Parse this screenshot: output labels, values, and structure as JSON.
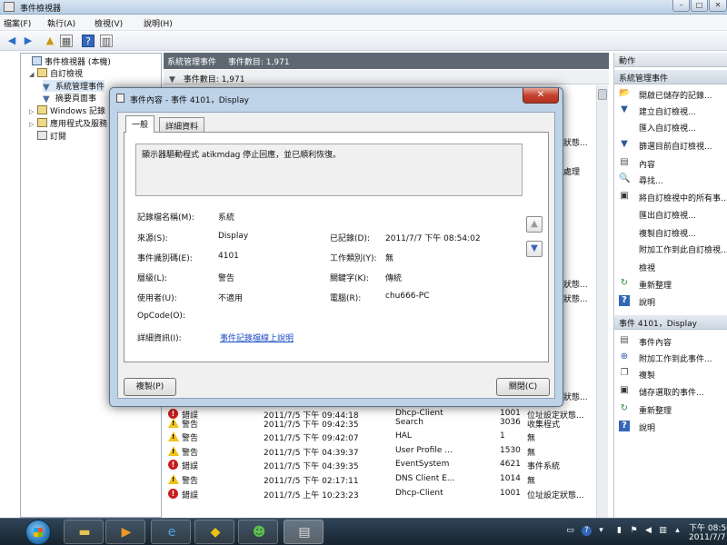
{
  "window": {
    "title": "事件檢視器",
    "controls": [
      "–",
      "□",
      "✕"
    ]
  },
  "menu": [
    "檔案(F)",
    "執行(A)",
    "檢視(V)",
    "說明(H)"
  ],
  "tree": {
    "items": [
      {
        "label": "事件檢視器 (本機)",
        "icon": "computer-icon"
      },
      {
        "label": "自訂檢視",
        "icon": "folder-icon"
      },
      {
        "label": "系統管理事件",
        "icon": "filter-icon"
      },
      {
        "label": "摘要頁面事",
        "icon": "filter-icon"
      },
      {
        "label": "Windows 記錄",
        "icon": "folder-icon"
      },
      {
        "label": "應用程式及服務",
        "icon": "folder-icon"
      },
      {
        "label": "訂閱",
        "icon": "subscription-icon"
      }
    ]
  },
  "center": {
    "header_title": "系統管理事件",
    "header_count": "事件數目: 1,971",
    "filter_count": "事件數目: 1,971",
    "behind_fragments": [
      "狀態...",
      "處理",
      "狀態...",
      "狀態...",
      "狀態..."
    ],
    "events": [
      {
        "level": "錯誤",
        "type": "error",
        "datetime": "2011/7/5 下午 09:44:18",
        "source": "Dhcp-Client",
        "id": "1001",
        "category": "位址設定狀態..."
      },
      {
        "level": "警告",
        "type": "warning",
        "datetime": "2011/7/5 下午 09:42:35",
        "source": "Search",
        "id": "3036",
        "category": "收集程式"
      },
      {
        "level": "警告",
        "type": "warning",
        "datetime": "2011/7/5 下午 09:42:07",
        "source": "HAL",
        "id": "1",
        "category": "無"
      },
      {
        "level": "警告",
        "type": "warning",
        "datetime": "2011/7/5 下午 04:39:37",
        "source": "User Profile ...",
        "id": "1530",
        "category": "無"
      },
      {
        "level": "錯誤",
        "type": "error",
        "datetime": "2011/7/5 下午 04:39:35",
        "source": "EventSystem",
        "id": "4621",
        "category": "事件系統"
      },
      {
        "level": "警告",
        "type": "warning",
        "datetime": "2011/7/5 下午 02:17:11",
        "source": "DNS Client E...",
        "id": "1014",
        "category": "無"
      },
      {
        "level": "錯誤",
        "type": "error",
        "datetime": "2011/7/5 上午 10:23:23",
        "source": "Dhcp-Client",
        "id": "1001",
        "category": "位址設定狀態..."
      }
    ]
  },
  "actions": {
    "section1_title": "動作",
    "section1_subtitle": "系統管理事件",
    "section1_items": [
      {
        "label": "開啟已儲存的記錄...",
        "icon": "open-log-icon",
        "glyph": "📂"
      },
      {
        "label": "建立自訂檢視...",
        "icon": "create-view-icon",
        "glyph": "▼"
      },
      {
        "label": "匯入自訂檢視...",
        "icon": "",
        "glyph": ""
      },
      {
        "label": "篩選目前自訂檢視...",
        "icon": "filter-icon",
        "glyph": "▼"
      },
      {
        "label": "內容",
        "icon": "properties-icon",
        "glyph": "▤"
      },
      {
        "label": "尋找...",
        "icon": "find-icon",
        "glyph": "🔍"
      },
      {
        "label": "將自訂檢視中的所有事...",
        "icon": "save-icon",
        "glyph": "▣"
      },
      {
        "label": "匯出自訂檢視...",
        "icon": "",
        "glyph": ""
      },
      {
        "label": "複製自訂檢視...",
        "icon": "",
        "glyph": ""
      },
      {
        "label": "附加工作到此自訂檢視...",
        "icon": "",
        "glyph": ""
      },
      {
        "label": "檢視",
        "icon": "",
        "glyph": ""
      },
      {
        "label": "重新整理",
        "icon": "refresh-icon",
        "glyph": "↻"
      },
      {
        "label": "說明",
        "icon": "help-icon",
        "glyph": "?"
      }
    ],
    "section2_title": "事件 4101，Display",
    "section2_items": [
      {
        "label": "事件內容",
        "icon": "event-properties-icon",
        "glyph": "▤"
      },
      {
        "label": "附加工作到此事件...",
        "icon": "attach-task-icon",
        "glyph": "⊕"
      },
      {
        "label": "複製",
        "icon": "copy-icon",
        "glyph": "❐"
      },
      {
        "label": "儲存選取的事件...",
        "icon": "save-icon",
        "glyph": "▣"
      },
      {
        "label": "重新整理",
        "icon": "refresh-icon",
        "glyph": "↻"
      },
      {
        "label": "說明",
        "icon": "help-icon",
        "glyph": "?"
      }
    ]
  },
  "dialog": {
    "title": "事件內容 - 事件 4101，Display",
    "close_glyph": "✕",
    "tabs": [
      "一般",
      "詳細資料"
    ],
    "description": "顯示器驅動程式 atikmdag 停止回應，並已順利恢復。",
    "fields": {
      "log_name_label": "記錄檔名稱(M):",
      "log_name_value": "系統",
      "source_label": "來源(S):",
      "source_value": "Display",
      "logged_label": "已記錄(D):",
      "logged_value": "2011/7/7 下午 08:54:02",
      "event_id_label": "事件識別碼(E):",
      "event_id_value": "4101",
      "task_category_label": "工作類別(Y):",
      "task_category_value": "無",
      "level_label": "層級(L):",
      "level_value": "警告",
      "keywords_label": "關鍵字(K):",
      "keywords_value": "傳統",
      "user_label": "使用者(U):",
      "user_value": "不適用",
      "computer_label": "電腦(R):",
      "computer_value": "chu666-PC",
      "opcode_label": "OpCode(O):",
      "more_info_label": "詳細資訊(I):",
      "more_info_link": "事件記錄檔線上說明"
    },
    "copy_button": "複製(P)",
    "close_button": "關閉(C)"
  },
  "taskbar": {
    "clock_time": "下午 08:56",
    "clock_date": "2011/7/7"
  }
}
